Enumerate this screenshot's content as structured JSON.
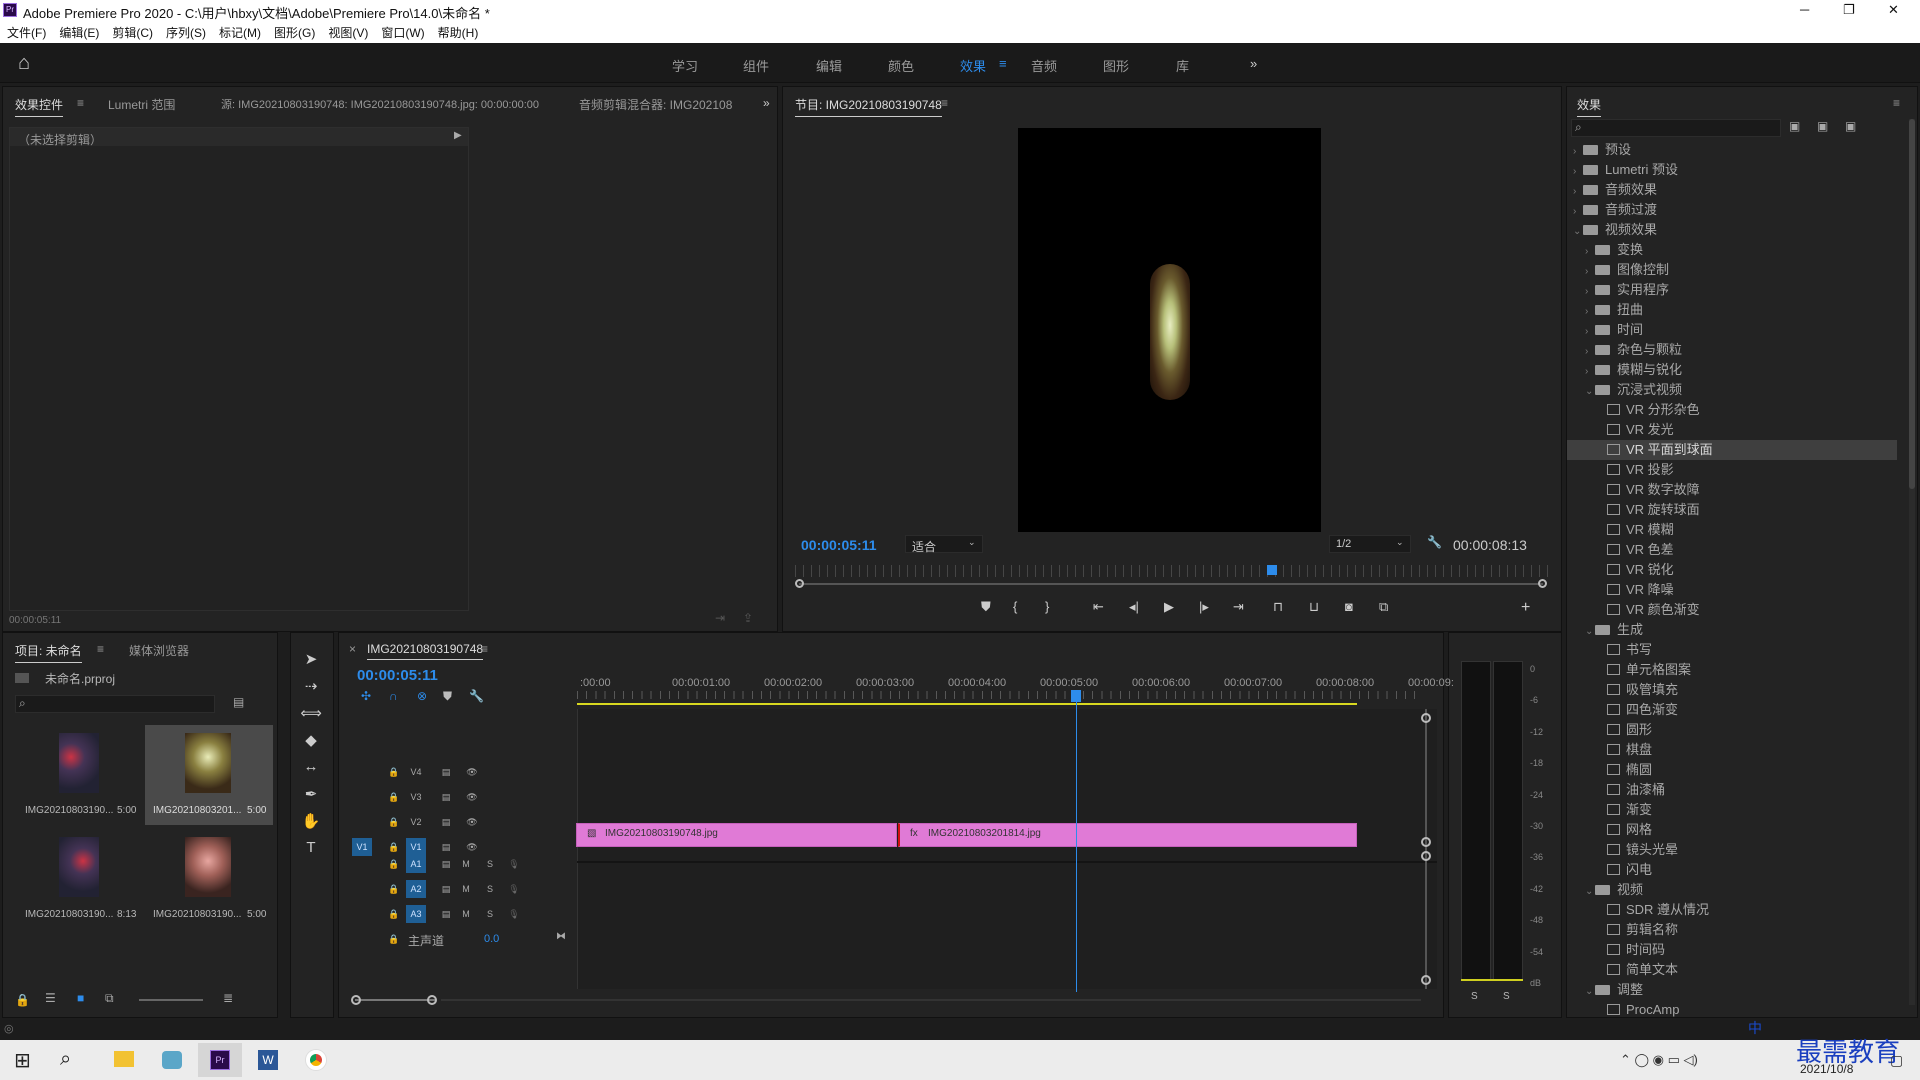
{
  "window": {
    "title": "Adobe Premiere Pro 2020 - C:\\用户\\hbxy\\文档\\Adobe\\Premiere Pro\\14.0\\未命名 *",
    "minimize": "─",
    "maximize": "❐",
    "close": "✕"
  },
  "menu": [
    "文件(F)",
    "编辑(E)",
    "剪辑(C)",
    "序列(S)",
    "标记(M)",
    "图形(G)",
    "视图(V)",
    "窗口(W)",
    "帮助(H)"
  ],
  "workspaces": {
    "items": [
      "学习",
      "组件",
      "编辑",
      "颜色",
      "效果",
      "音频",
      "图形",
      "库"
    ],
    "active": "效果",
    "more": "»"
  },
  "source_panel": {
    "tabs": [
      "效果控件",
      "Lumetri 范围",
      "源: IMG20210803190748: IMG20210803190748.jpg: 00:00:00:00",
      "音频剪辑混合器: IMG202108"
    ],
    "no_clip": "（未选择剪辑）",
    "timecode": "00:00:05:11"
  },
  "program": {
    "title": "节目: IMG20210803190748",
    "timecode": "00:00:05:11",
    "fit": "适合",
    "resolution": "1/2",
    "duration": "00:00:08:13"
  },
  "effects_panel": {
    "title": "效果",
    "tree": [
      {
        "label": "预设",
        "level": 0,
        "type": "folder",
        "open": false
      },
      {
        "label": "Lumetri 预设",
        "level": 0,
        "type": "folder",
        "open": false
      },
      {
        "label": "音频效果",
        "level": 0,
        "type": "folder",
        "open": false
      },
      {
        "label": "音频过渡",
        "level": 0,
        "type": "folder",
        "open": false
      },
      {
        "label": "视频效果",
        "level": 0,
        "type": "folder",
        "open": true
      },
      {
        "label": "变换",
        "level": 1,
        "type": "folder",
        "open": false
      },
      {
        "label": "图像控制",
        "level": 1,
        "type": "folder",
        "open": false
      },
      {
        "label": "实用程序",
        "level": 1,
        "type": "folder",
        "open": false
      },
      {
        "label": "扭曲",
        "level": 1,
        "type": "folder",
        "open": false
      },
      {
        "label": "时间",
        "level": 1,
        "type": "folder",
        "open": false
      },
      {
        "label": "杂色与颗粒",
        "level": 1,
        "type": "folder",
        "open": false
      },
      {
        "label": "模糊与锐化",
        "level": 1,
        "type": "folder",
        "open": false
      },
      {
        "label": "沉浸式视频",
        "level": 1,
        "type": "folder",
        "open": true
      },
      {
        "label": "VR 分形杂色",
        "level": 2,
        "type": "fx"
      },
      {
        "label": "VR 发光",
        "level": 2,
        "type": "fx"
      },
      {
        "label": "VR 平面到球面",
        "level": 2,
        "type": "fx",
        "selected": true
      },
      {
        "label": "VR 投影",
        "level": 2,
        "type": "fx"
      },
      {
        "label": "VR 数字故障",
        "level": 2,
        "type": "fx"
      },
      {
        "label": "VR 旋转球面",
        "level": 2,
        "type": "fx"
      },
      {
        "label": "VR 模糊",
        "level": 2,
        "type": "fx"
      },
      {
        "label": "VR 色差",
        "level": 2,
        "type": "fx"
      },
      {
        "label": "VR 锐化",
        "level": 2,
        "type": "fx"
      },
      {
        "label": "VR 降噪",
        "level": 2,
        "type": "fx"
      },
      {
        "label": "VR 颜色渐变",
        "level": 2,
        "type": "fx"
      },
      {
        "label": "生成",
        "level": 1,
        "type": "folder",
        "open": true
      },
      {
        "label": "书写",
        "level": 2,
        "type": "fx"
      },
      {
        "label": "单元格图案",
        "level": 2,
        "type": "fx"
      },
      {
        "label": "吸管填充",
        "level": 2,
        "type": "fx"
      },
      {
        "label": "四色渐变",
        "level": 2,
        "type": "fx"
      },
      {
        "label": "圆形",
        "level": 2,
        "type": "fx"
      },
      {
        "label": "棋盘",
        "level": 2,
        "type": "fx"
      },
      {
        "label": "椭圆",
        "level": 2,
        "type": "fx"
      },
      {
        "label": "油漆桶",
        "level": 2,
        "type": "fx"
      },
      {
        "label": "渐变",
        "level": 2,
        "type": "fx"
      },
      {
        "label": "网格",
        "level": 2,
        "type": "fx"
      },
      {
        "label": "镜头光晕",
        "level": 2,
        "type": "fx"
      },
      {
        "label": "闪电",
        "level": 2,
        "type": "fx"
      },
      {
        "label": "视频",
        "level": 1,
        "type": "folder",
        "open": true
      },
      {
        "label": "SDR 遵从情况",
        "level": 2,
        "type": "fx"
      },
      {
        "label": "剪辑名称",
        "level": 2,
        "type": "fx"
      },
      {
        "label": "时间码",
        "level": 2,
        "type": "fx"
      },
      {
        "label": "简单文本",
        "level": 2,
        "type": "fx"
      },
      {
        "label": "调整",
        "level": 1,
        "type": "folder",
        "open": true
      },
      {
        "label": "ProcAmp",
        "level": 2,
        "type": "fx"
      }
    ]
  },
  "project": {
    "tabs": [
      "项目: 未命名",
      "媒体浏览器"
    ],
    "file": "未命名.prproj",
    "items": [
      {
        "name": "IMG20210803190...",
        "duration": "5:00"
      },
      {
        "name": "IMG20210803201...",
        "duration": "5:00"
      },
      {
        "name": "IMG20210803190...",
        "duration": "8:13"
      },
      {
        "name": "IMG20210803190...",
        "duration": "5:00"
      }
    ]
  },
  "timeline": {
    "sequence": "IMG20210803190748",
    "timecode": "00:00:05:11",
    "ruler": [
      ":00:00",
      "00:00:01:00",
      "00:00:02:00",
      "00:00:03:00",
      "00:00:04:00",
      "00:00:05:00",
      "00:00:06:00",
      "00:00:07:00",
      "00:00:08:00",
      "00:00:09:"
    ],
    "video_tracks": [
      "V4",
      "V3",
      "V2",
      "V1"
    ],
    "audio_tracks": [
      "A1",
      "A2",
      "A3"
    ],
    "source_patch": "V1",
    "master": {
      "label": "主声道",
      "value": "0.0"
    },
    "mute": "M",
    "solo": "S",
    "clips": [
      {
        "name": "IMG20210803190748.jpg",
        "start": 0,
        "end": 3.5
      },
      {
        "name": "IMG20210803201814.jpg",
        "start": 3.5,
        "end": 8.5
      }
    ],
    "playhead_seconds": 5.44
  },
  "audio_meter": {
    "scale": [
      "0",
      "-6",
      "-12",
      "-18",
      "-24",
      "-30",
      "-36",
      "-42",
      "-48",
      "-54",
      "dB"
    ],
    "solo": "S"
  },
  "taskbar": {
    "date": "2021/10/8",
    "watermark": "最需教育",
    "ime": "中"
  }
}
